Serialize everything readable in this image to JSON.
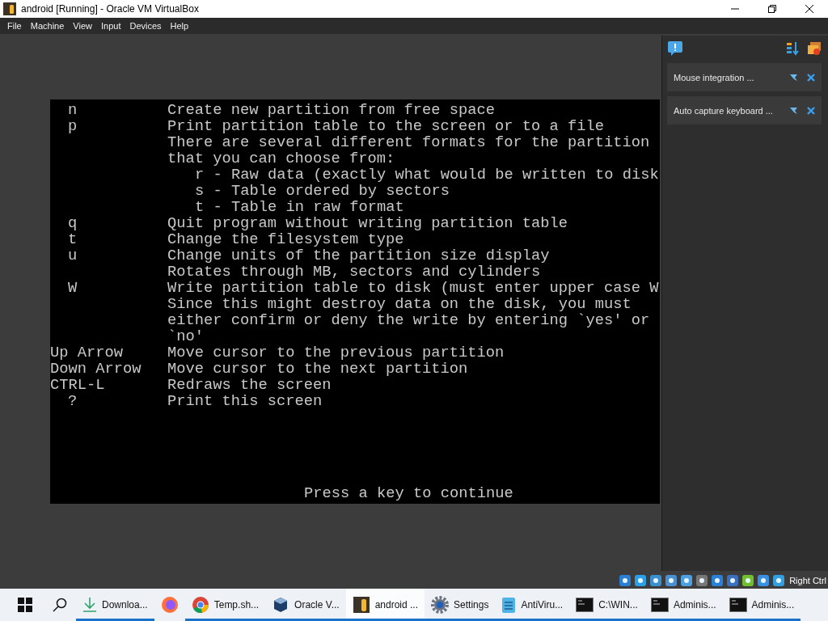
{
  "window": {
    "title": "android [Running] - Oracle VM VirtualBox"
  },
  "menu": [
    "File",
    "Machine",
    "View",
    "Input",
    "Devices",
    "Help"
  ],
  "console": {
    "rows": [
      {
        "key": "n",
        "text": "Create new partition from free space"
      },
      {
        "key": "p",
        "text": "Print partition table to the screen or to a file"
      },
      {
        "text": "There are several different formats for the partition"
      },
      {
        "text": "that you can choose from:"
      },
      {
        "kind": "sub",
        "text": "r - Raw data (exactly what would be written to disk"
      },
      {
        "kind": "sub",
        "text": "s - Table ordered by sectors"
      },
      {
        "kind": "sub",
        "text": "t - Table in raw format"
      },
      {
        "key": "q",
        "text": "Quit program without writing partition table"
      },
      {
        "key": "t",
        "text": "Change the filesystem type"
      },
      {
        "key": "u",
        "text": "Change units of the partition size display"
      },
      {
        "text": "Rotates through MB, sectors and cylinders"
      },
      {
        "key": "W",
        "text": "Write partition table to disk (must enter upper case W"
      },
      {
        "text": "Since this might destroy data on the disk, you must"
      },
      {
        "text": "either confirm or deny the write by entering `yes' or"
      },
      {
        "text": "`no'"
      },
      {
        "key": "Up Arrow",
        "text": "Move cursor to the previous partition"
      },
      {
        "key": "Down Arrow",
        "text": "Move cursor to the next partition"
      },
      {
        "key": "CTRL-L",
        "text": "Redraws the screen"
      },
      {
        "key": "?",
        "text": "Print this screen"
      }
    ],
    "prompt": "Press a key to continue"
  },
  "notifications": [
    {
      "text": "Mouse integration ..."
    },
    {
      "text": "Auto capture keyboard ..."
    }
  ],
  "status_bar": {
    "host_key": "Right Ctrl"
  },
  "taskbar": [
    {
      "kind": "download",
      "label": "Downloa...",
      "running": true,
      "selected": false
    },
    {
      "kind": "firefox",
      "running": false,
      "selected": false
    },
    {
      "kind": "chrome",
      "label": "Temp.sh...",
      "running": true,
      "selected": false
    },
    {
      "kind": "vbox",
      "label": "Oracle V...",
      "running": true,
      "selected": false
    },
    {
      "kind": "android",
      "label": "android ...",
      "running": true,
      "selected": true
    },
    {
      "kind": "settings",
      "label": "Settings",
      "running": true,
      "selected": false
    },
    {
      "kind": "notepad",
      "label": "AntiViru...",
      "running": true,
      "selected": false
    },
    {
      "kind": "cmd",
      "label": "C:\\WIN...",
      "running": true,
      "selected": false
    },
    {
      "kind": "cmd",
      "label": "Adminis...",
      "running": true,
      "selected": false
    },
    {
      "kind": "cmd",
      "label": "Adminis...",
      "running": true,
      "selected": false
    }
  ]
}
